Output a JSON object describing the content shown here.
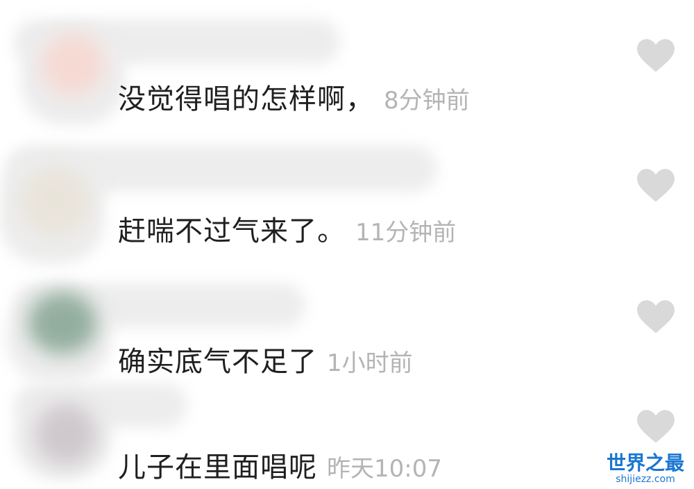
{
  "comments": [
    {
      "text": "没觉得唱的怎样啊，",
      "time": "8分钟前",
      "like_icon": "heart-icon",
      "avatar_color": "#f6d9d3"
    },
    {
      "text": "赶喘不过气来了。",
      "time": "11分钟前",
      "like_icon": "heart-icon",
      "avatar_color": "#e9e4da"
    },
    {
      "text": "确实底气不足了",
      "time": "1小时前",
      "like_icon": "heart-icon",
      "avatar_color": "#93ae9f"
    },
    {
      "text": "儿子在里面唱呢",
      "time": "昨天10:07",
      "like_icon": "heart-icon",
      "avatar_color": "#cfc9cd"
    }
  ],
  "colors": {
    "text": "#1f1f1f",
    "time": "#b4b4b4",
    "heart": "#d9d9d9",
    "watermark": "#1976d2"
  },
  "watermark": {
    "title": "世界之最",
    "url": "shijiezz.com"
  }
}
